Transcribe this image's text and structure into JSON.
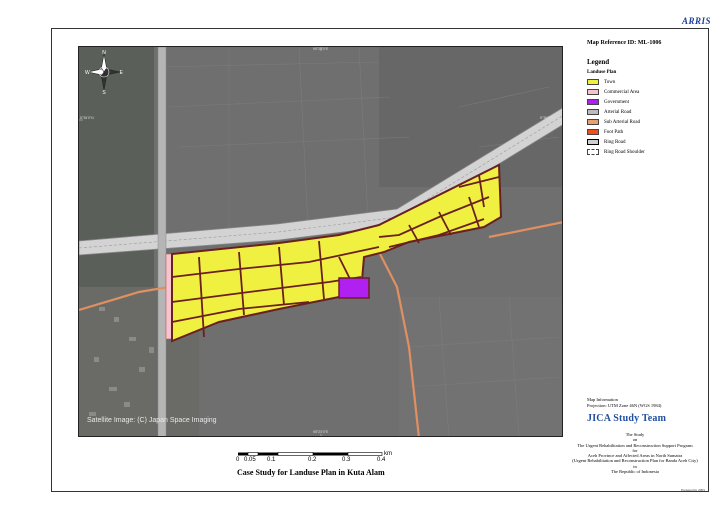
{
  "header": {
    "brand": "ARRIS"
  },
  "map": {
    "credit": "Satellite Image: (C) Japan Space Imaging",
    "grid_labels": [
      "95°20'0\"E",
      "95°20'0\"E",
      "5°36'0\"N",
      "5°36'0\"N"
    ],
    "compass": {
      "n": "N",
      "s": "S",
      "e": "E",
      "w": "W"
    },
    "scale": {
      "unit": "km",
      "ticks": [
        "0",
        "0.05",
        "0.1",
        "0.2",
        "0.3",
        "0.4"
      ]
    },
    "title": "Case Study for Landuse Plan in Kuta Alam"
  },
  "sidebar": {
    "map_reference": "Map Reference ID: ML-1006",
    "legend_title": "Legend",
    "landuse_heading": "Landuse Plan",
    "legend_items": [
      {
        "label": "Town",
        "color": "#f0f040"
      },
      {
        "label": "Commercial Area",
        "color": "#f6c4cc"
      },
      {
        "label": "Government",
        "color": "#b020f0"
      },
      {
        "label": "Arterial Road",
        "color": "#bcbcbc"
      },
      {
        "label": "Sub Arterial Road",
        "color": "#e8a070"
      },
      {
        "label": "Foot Path",
        "color": "#f0501a"
      },
      {
        "label": "Ring Road",
        "color": "#cfcfcf"
      },
      {
        "label": "Ring Road Shoulder",
        "color": "#ffffff"
      }
    ],
    "map_info": {
      "heading": "Map Information",
      "projection": "Projection: UTM Zone 46N (WGS 1984)"
    },
    "team": "JICA Study Team",
    "study_lines": [
      "The Study",
      "on",
      "The Urgent Rehabilitation and Reconstruction Support Program",
      "for",
      "Aceh Province and Affected Areas in North Sumatra",
      "(Urgent Rehabilitation and Reconstruction Plan for Banda Aceh City)",
      "in",
      "The Republic of Indonesia"
    ],
    "prepared": "Prepared in 2005"
  }
}
